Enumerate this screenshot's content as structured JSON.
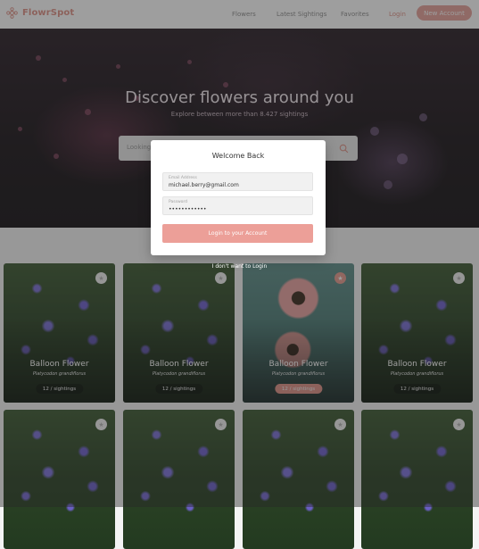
{
  "header": {
    "logo_text": "FlowrSpot",
    "nav": [
      "Flowers",
      "Latest Sightings",
      "Favorites"
    ],
    "login_label": "Login",
    "new_account_label": "New Account"
  },
  "hero": {
    "title": "Discover flowers around you",
    "subtitle": "Explore between more than 8.427 sightings",
    "search_placeholder": "Looking for something specific?"
  },
  "cards": [
    {
      "name": "Balloon Flower",
      "latin": "Platycodon grandiflorus",
      "sightings": "12 / sightings",
      "favorite": false
    },
    {
      "name": "Balloon Flower",
      "latin": "Platycodon grandiflorus",
      "sightings": "12 / sightings",
      "favorite": false
    },
    {
      "name": "Balloon Flower",
      "latin": "Platycodon grandiflorus",
      "sightings": "12 / sightings",
      "favorite": true
    },
    {
      "name": "Balloon Flower",
      "latin": "Platycodon grandiflorus",
      "sightings": "12 / sightings",
      "favorite": false
    }
  ],
  "modal": {
    "title": "Welcome Back",
    "email_label": "Email Address",
    "email_value": "michael.berry@gmail.com",
    "password_label": "Password",
    "password_value": "••••••••••••",
    "login_button": "Login to your Account",
    "forgot_text": "I don't want to Login"
  },
  "colors": {
    "accent": "#df9186",
    "accent_light": "#ec9f98"
  }
}
